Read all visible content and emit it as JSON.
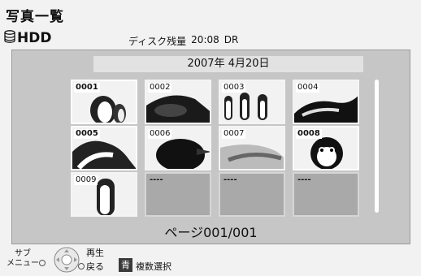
{
  "header": {
    "title": "写真一覧",
    "source_label": "HDD",
    "disk_label": "ディスク残量",
    "disk_time": "20:08",
    "disk_mode": "DR"
  },
  "date_label": "2007年 4月20日",
  "thumbnails": [
    {
      "num": "0001",
      "photo": true,
      "selected": true
    },
    {
      "num": "0002",
      "photo": true,
      "selected": false
    },
    {
      "num": "0003",
      "photo": true,
      "selected": false
    },
    {
      "num": "0004",
      "photo": true,
      "selected": false
    },
    {
      "num": "0005",
      "photo": true,
      "selected": true
    },
    {
      "num": "0006",
      "photo": true,
      "selected": false
    },
    {
      "num": "0007",
      "photo": true,
      "selected": false
    },
    {
      "num": "0008",
      "photo": true,
      "selected": true
    },
    {
      "num": "0009",
      "photo": true,
      "selected": false
    },
    {
      "num": "----",
      "photo": false,
      "selected": false
    },
    {
      "num": "----",
      "photo": false,
      "selected": false
    },
    {
      "num": "----",
      "photo": false,
      "selected": false
    }
  ],
  "page_indicator": "ページ001/001",
  "footer": {
    "sub_menu_line1": "サブ",
    "sub_menu_line2": "メニュー",
    "play_label": "再生",
    "back_label": "戻る",
    "blue_key_label": "青",
    "multi_select_label": "複数選択"
  }
}
